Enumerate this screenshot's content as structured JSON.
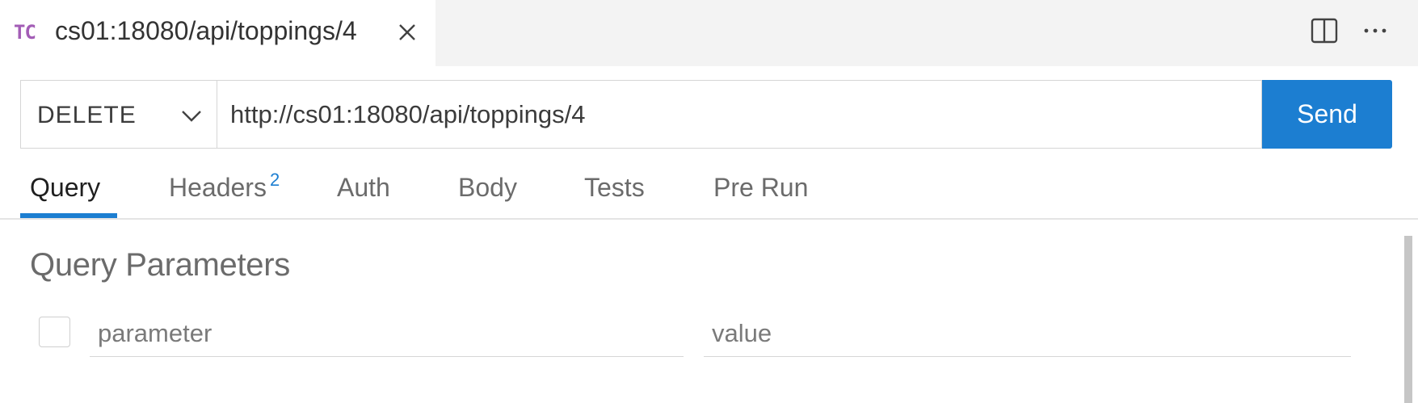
{
  "tab": {
    "logo": "TC",
    "title": "cs01:18080/api/toppings/4"
  },
  "toolbar": {
    "icons": [
      "split-editor-icon",
      "more-actions-icon"
    ]
  },
  "request": {
    "method": "DELETE",
    "url": "http://cs01:18080/api/toppings/4",
    "send_label": "Send"
  },
  "request_tabs": [
    {
      "label": "Query",
      "active": true
    },
    {
      "label": "Headers",
      "badge": "2"
    },
    {
      "label": "Auth"
    },
    {
      "label": "Body"
    },
    {
      "label": "Tests"
    },
    {
      "label": "Pre Run"
    }
  ],
  "query": {
    "title": "Query Parameters",
    "param_placeholder": "parameter",
    "value_placeholder": "value"
  },
  "colors": {
    "accent": "#1c7ed1",
    "logo": "#a35db6",
    "tab_bar_bg": "#f3f3f3"
  }
}
